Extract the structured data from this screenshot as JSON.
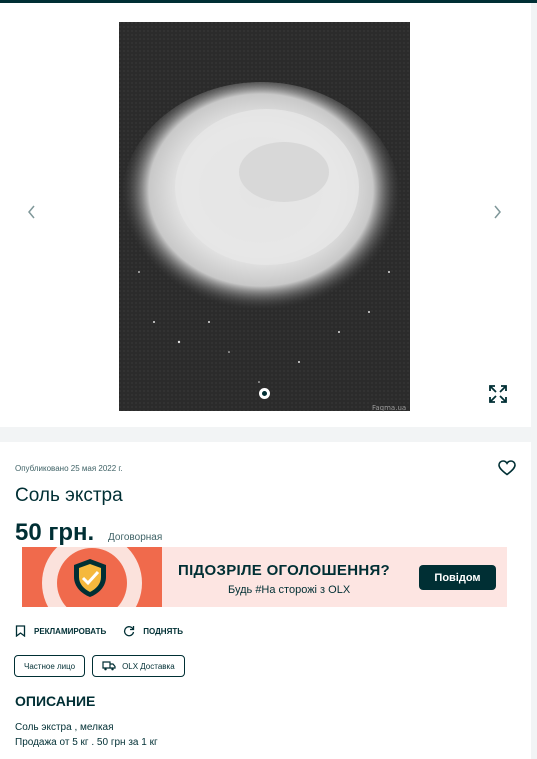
{
  "gallery": {
    "image_alt": "salt",
    "watermark": "Faqma.ua",
    "prev_icon": "chevron-left-icon",
    "next_icon": "chevron-right-icon",
    "expand_icon": "expand-icon"
  },
  "ad": {
    "published": "Опубликовано 25 мая 2022 г.",
    "title": "Соль экстра",
    "price": "50 грн.",
    "negotiable": "Договорная",
    "favorite_icon": "heart-icon"
  },
  "banner": {
    "heading": "ПІДОЗРІЛЕ ОГОЛОШЕННЯ?",
    "subtext": "Будь #На сторожі з OLX",
    "button": "Повідом",
    "colors": {
      "accent": "#f06a4c",
      "background": "#fde5e2",
      "dark": "#002f34"
    }
  },
  "actions": {
    "promote": "РЕКЛАМИРОВАТЬ",
    "raise": "ПОДНЯТЬ"
  },
  "tags": {
    "seller_type": "Частное лицо",
    "delivery": "OLX Доставка"
  },
  "description": {
    "heading": "ОПИСАНИЕ",
    "line1": "Соль экстра , мелкая",
    "line2": "Продажа от 5 кг . 50 грн за 1 кг"
  }
}
